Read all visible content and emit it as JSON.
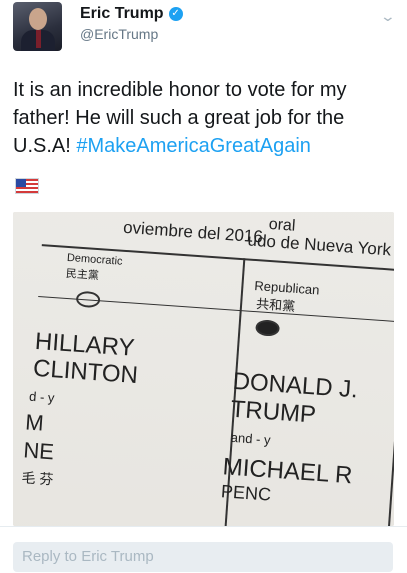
{
  "tweet": {
    "author_name": "Eric Trump",
    "author_handle": "@EricTrump",
    "text_before_hashtag": "It is an incredible honor to vote for my father! He will such a great job for the U.S.A! ",
    "hashtag": "#MakeAmericaGreatAgain",
    "flag_emoji": "us-flag-icon"
  },
  "photo": {
    "ballot_header_left": "oviembre del 2016",
    "ballot_header_right": "udo de Nueva York",
    "ballot_header_top": "oral",
    "democratic_label": "Democratic",
    "democratic_chinese": "民主黨",
    "republican_label": "Republican",
    "republican_chinese": "共和黨",
    "dem_name_1": "HILLARY",
    "dem_name_2": "CLINTON",
    "dem_and": "d - y",
    "dem_vp_1": "M",
    "dem_vp_2": "NE",
    "dem_chinese_bottom": "毛 芬",
    "rep_name_1": "DONALD J.",
    "rep_name_2": "TRUMP",
    "rep_and": "and - y",
    "rep_vp_1": "MICHAEL R",
    "rep_vp_2": "PENC",
    "right_letter_1": "L",
    "right_letter_2": "T",
    "right_and": "and"
  },
  "reply": {
    "placeholder": "Reply to Eric Trump"
  },
  "colors": {
    "hashtag": "#1da1f2",
    "verified": "#1da1f2",
    "handle": "#657786"
  }
}
